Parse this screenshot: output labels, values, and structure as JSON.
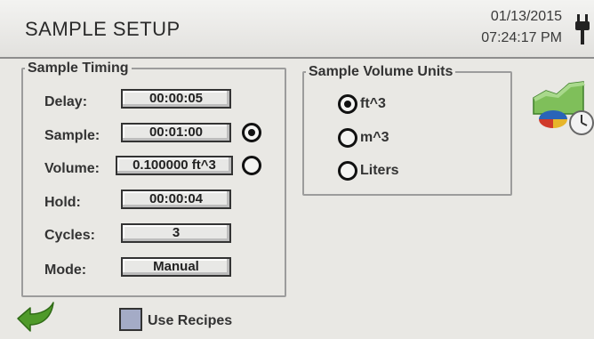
{
  "header": {
    "title": "SAMPLE SETUP",
    "date": "01/13/2015",
    "time": "07:24:17 PM"
  },
  "sample_timing": {
    "legend": "Sample Timing",
    "rows": [
      {
        "label": "Delay:",
        "value": "00:00:05"
      },
      {
        "label": "Sample:",
        "value": "00:01:00"
      },
      {
        "label": "Volume:",
        "value": "0.100000 ft^3"
      },
      {
        "label": "Hold:",
        "value": "00:00:04"
      },
      {
        "label": "Cycles:",
        "value": "3"
      },
      {
        "label": "Mode:",
        "value": "Manual"
      }
    ],
    "selected_basis": "Sample"
  },
  "volume_units": {
    "legend": "Sample Volume Units",
    "options": [
      {
        "label": "ft^3",
        "selected": true
      },
      {
        "label": "m^3",
        "selected": false
      },
      {
        "label": "Liters",
        "selected": false
      }
    ]
  },
  "footer": {
    "use_recipes_label": "Use Recipes",
    "use_recipes_checked": false
  },
  "icons": {
    "back": "back-arrow-icon",
    "power": "power-plug-icon",
    "chart": "chart-clock-icon"
  },
  "colors": {
    "background": "#e9e8e4",
    "arrow_green": "#4f9a2a",
    "checkbox_fill": "#a4abc6"
  }
}
